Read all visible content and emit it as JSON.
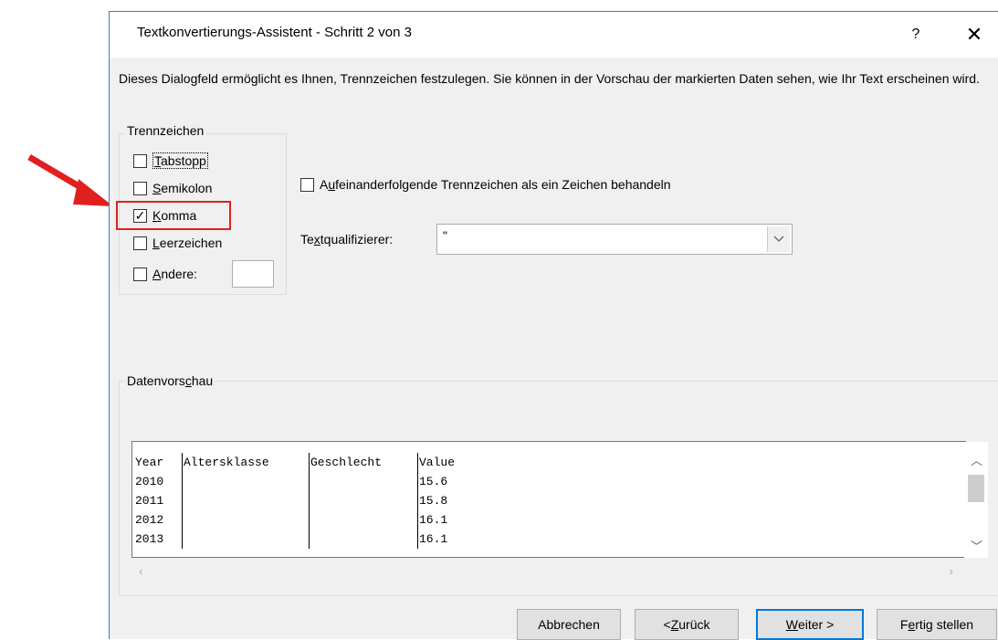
{
  "dialog": {
    "title": "Textkonvertierungs-Assistent - Schritt 2 von 3",
    "help_label": "?",
    "close_label": "✕",
    "intro": "Dieses Dialogfeld ermöglicht es Ihnen, Trennzeichen festzulegen. Sie können in der Vorschau der markierten Daten sehen, wie Ihr Text erscheinen wird."
  },
  "delimiters": {
    "legend": "Trennzeichen",
    "options": [
      {
        "pre": "",
        "key": "T",
        "post": "abstopp",
        "checked": false
      },
      {
        "pre": "",
        "key": "S",
        "post": "emikolon",
        "checked": false
      },
      {
        "pre": "",
        "key": "K",
        "post": "omma",
        "checked": true
      },
      {
        "pre": "",
        "key": "L",
        "post": "eerzeichen",
        "checked": false
      },
      {
        "pre": "",
        "key": "A",
        "post": "ndere:",
        "checked": false
      }
    ],
    "andere_value": ""
  },
  "consecutive": {
    "pre": "A",
    "key": "u",
    "post": "feinanderfolgende Trennzeichen als ein Zeichen behandeln",
    "checked": false
  },
  "qualifier": {
    "pre": "Te",
    "key": "x",
    "post": "tqualifizierer:",
    "value": "\""
  },
  "preview": {
    "legend_pre": "Datenvors",
    "legend_key": "c",
    "legend_post": "hau",
    "columns": [
      "Year",
      "Altersklasse",
      "Geschlecht",
      "Value"
    ],
    "rows": [
      [
        "2010",
        "",
        "",
        "15.6"
      ],
      [
        "2011",
        "",
        "",
        "15.8"
      ],
      [
        "2012",
        "",
        "",
        "16.1"
      ],
      [
        "2013",
        "",
        "",
        "16.1"
      ]
    ]
  },
  "buttons": {
    "cancel": "Abbrechen",
    "back_pre": "< ",
    "back_key": "Z",
    "back_post": "urück",
    "next_key": "W",
    "next_post": "eiter >",
    "finish_pre": "F",
    "finish_key": "e",
    "finish_post": "rtig stellen"
  },
  "colors": {
    "annotation": "#e02020",
    "accent": "#0078d7"
  }
}
